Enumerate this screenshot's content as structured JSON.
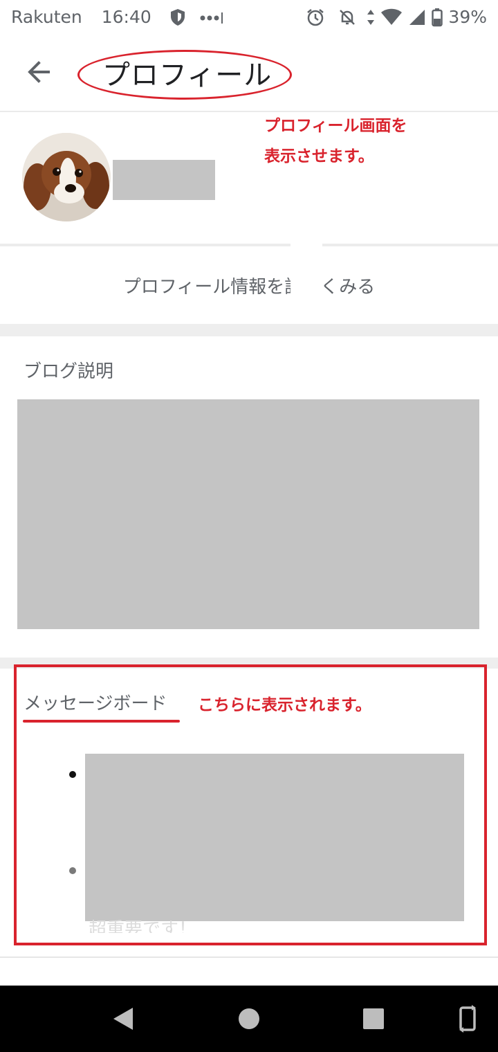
{
  "status_bar": {
    "carrier": "Rakuten",
    "time": "16:40",
    "battery": "39%",
    "icons": [
      "shield-icon",
      "more-dots-icon",
      "alarm-icon",
      "notifications-off-icon",
      "data-arrows-icon",
      "wifi-icon",
      "signal-icon",
      "battery-icon"
    ]
  },
  "app_bar": {
    "back_icon": "arrow-back-icon",
    "title": "プロフィール"
  },
  "profile": {
    "annotation": "プロフィール画面を\n表示させます。",
    "link_text": "プロフィール情報を詳しくみる"
  },
  "blog": {
    "title": "ブログ説明"
  },
  "message_board": {
    "title": "メッセージボード",
    "annotation": "こちらに表示されます。",
    "peek_text": "超重要です！"
  },
  "nav_bar": {
    "icons": [
      "back-triangle-icon",
      "home-circle-icon",
      "recents-square-icon",
      "rotate-icon"
    ]
  },
  "colors": {
    "accent_red": "#d9232d",
    "placeholder_gray": "#c4c4c4",
    "text_gray": "#5f6368"
  }
}
